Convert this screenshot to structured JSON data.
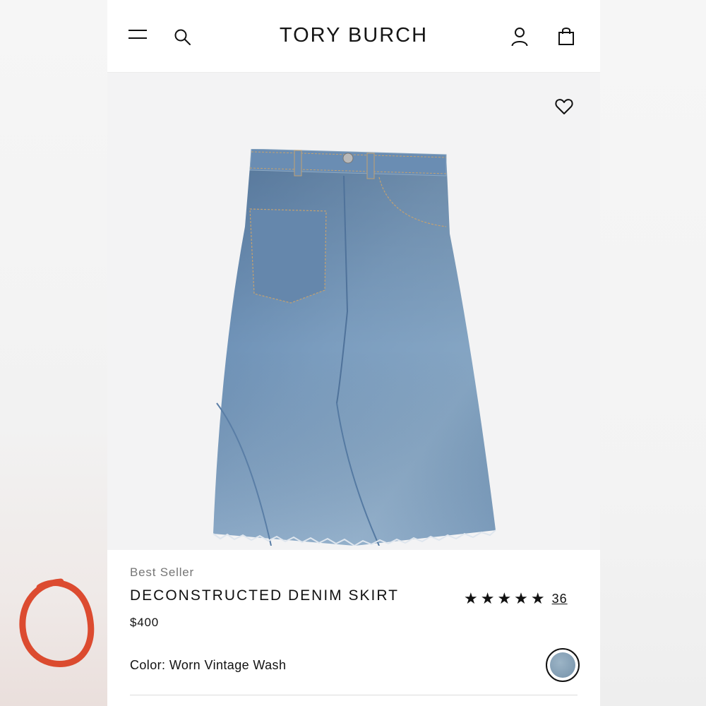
{
  "header": {
    "brand": "TORY BURCH",
    "icons": [
      "menu-icon",
      "search-icon",
      "account-icon",
      "shopping-bag-icon"
    ]
  },
  "product": {
    "image_alt": "Deconstructed denim skirt product photo",
    "badge": "Best Seller",
    "title": "DECONSTRUCTED DENIM SKIRT",
    "price": "$400",
    "rating": {
      "stars": "★★★★★",
      "value": 5,
      "review_count": "36"
    },
    "color": {
      "label": "Color: Worn Vintage Wash",
      "swatch_color": "#809aaf"
    }
  },
  "colors": {
    "accent_annotation": "#d93a1c",
    "denim_base": "#6f92b6"
  }
}
